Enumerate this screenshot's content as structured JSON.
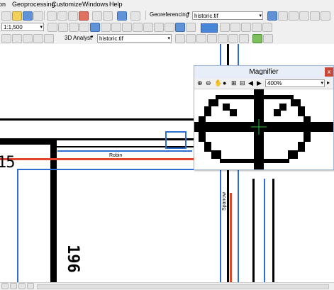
{
  "menu": {
    "items": [
      "on",
      "Geoprocessing",
      "Customize",
      "Windows",
      "Help"
    ]
  },
  "toolbar1": {
    "georef_label": "Georeferencing",
    "layer_value": "historic.tif"
  },
  "toolbar2": {
    "scale_value": "1:1,500"
  },
  "toolbar3": {
    "analyst_label": "3D Analyst",
    "layer_value": "historic.tif"
  },
  "map": {
    "street_robin": "Robin",
    "street_sparrow": "Sparrow",
    "number_left": "15",
    "number_vertical": "196"
  },
  "magnifier": {
    "title": "Magnifier",
    "close_glyph": "x",
    "zoom_value": "400%"
  },
  "colors": {
    "road": "#000000",
    "red_line": "#e0452b",
    "blue_line": "#2d6fd0"
  }
}
